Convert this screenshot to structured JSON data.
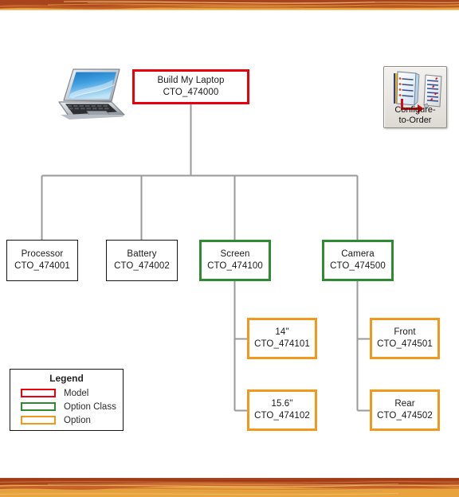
{
  "page": {
    "background_color": "#ffffff",
    "band_colors": {
      "light": "#e8a33d",
      "mid": "#c8642a",
      "dark": "#9e3d1c",
      "highlight": "#f2bf6a"
    }
  },
  "colors": {
    "model": "#e8000d",
    "option_class": "#2e8b32",
    "option": "#f0991e",
    "plain": "#151515",
    "connector": "#9a9a9a"
  },
  "illustration": {
    "laptop_alt": "laptop-illustration"
  },
  "cto_button": {
    "label_line1": "Configure-",
    "label_line2": "to-Order",
    "icon_name": "configure-to-order-icon"
  },
  "tree": {
    "root": {
      "name": "Build My Laptop",
      "code": "CTO_474000",
      "kind": "model"
    },
    "level2": [
      {
        "name": "Processor",
        "code": "CTO_474001",
        "kind": "plain"
      },
      {
        "name": "Battery",
        "code": "CTO_474002",
        "kind": "plain"
      },
      {
        "name": "Screen",
        "code": "CTO_474100",
        "kind": "option_class"
      },
      {
        "name": "Camera",
        "code": "CTO_474500",
        "kind": "option_class"
      }
    ],
    "screen_options": [
      {
        "name": "14\"",
        "code": "CTO_474101",
        "kind": "option"
      },
      {
        "name": "15.6\"",
        "code": "CTO_474102",
        "kind": "option"
      }
    ],
    "camera_options": [
      {
        "name": "Front",
        "code": "CTO_474501",
        "kind": "option"
      },
      {
        "name": "Rear",
        "code": "CTO_474502",
        "kind": "option"
      }
    ]
  },
  "legend": {
    "title": "Legend",
    "items": [
      {
        "label": "Model",
        "color": "#e8000d"
      },
      {
        "label": "Option Class",
        "color": "#2e8b32"
      },
      {
        "label": "Option",
        "color": "#f0991e"
      }
    ]
  }
}
